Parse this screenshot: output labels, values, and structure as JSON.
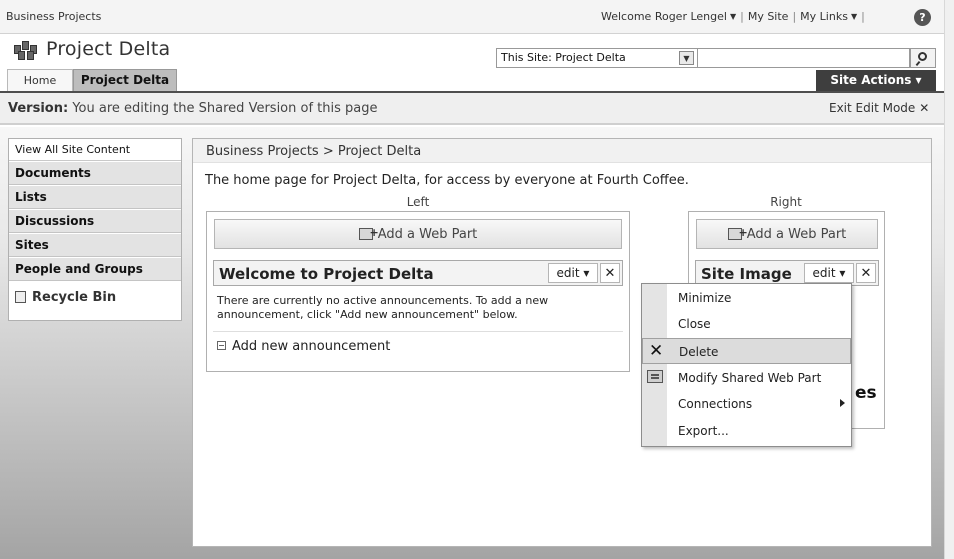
{
  "topbar": {
    "site_name": "Business Projects",
    "welcome": "Welcome Roger Lengel",
    "my_site": "My Site",
    "my_links": "My Links",
    "help_glyph": "?"
  },
  "header": {
    "site_title": "Project Delta",
    "search_scope": "This Site: Project Delta",
    "search_placeholder": "",
    "tabs": [
      {
        "label": "Home",
        "selected": false
      },
      {
        "label": "Project Delta",
        "selected": true
      }
    ],
    "site_actions": "Site Actions ▾"
  },
  "edit_bar": {
    "version_label": "Version:",
    "version_text": "You are editing the Shared Version of this page",
    "exit_label": "Exit Edit Mode"
  },
  "left_nav": {
    "view_all": "View All Site Content",
    "headings": [
      "Documents",
      "Lists",
      "Discussions",
      "Sites",
      "People and Groups"
    ],
    "recycle_bin": "Recycle Bin"
  },
  "main": {
    "breadcrumb": "Business Projects > Project Delta",
    "description": "The home page for Project Delta, for access by everyone at Fourth Coffee.",
    "zone_left_label": "Left",
    "zone_right_label": "Right",
    "add_web_part": "Add a Web Part",
    "edit_label": "edit ▾",
    "close_glyph": "✕",
    "web_parts": {
      "welcome_title": "Welcome to Project Delta",
      "site_image_title": "Site Image",
      "announcement_text": "There are currently no active announcements. To add a new announcement, click \"Add new announcement\" below.",
      "add_announcement": "Add new announcement",
      "partial_text": "es"
    }
  },
  "context_menu": {
    "items": [
      "Minimize",
      "Close",
      "Delete",
      "Modify Shared Web Part",
      "Connections",
      "Export..."
    ],
    "highlighted": "Delete"
  },
  "colors": {
    "accent_dark": "#3e3e3e",
    "selected_tab": "#bdbdbd",
    "nav_heading_bg": "#e3e3e3"
  }
}
